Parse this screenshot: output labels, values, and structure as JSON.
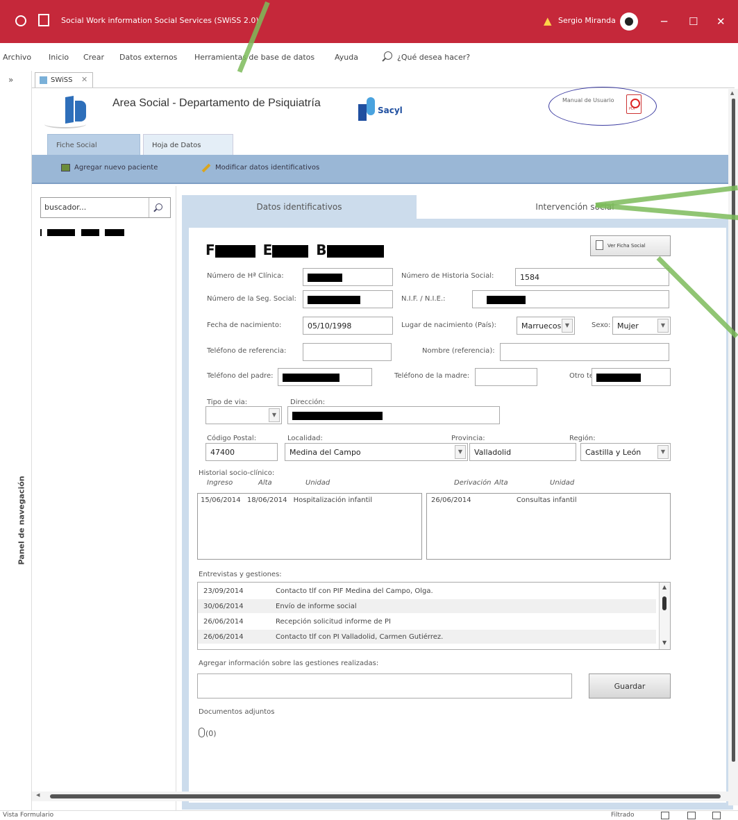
{
  "titlebar": {
    "title": "Social Work information Social Services (SWiSS 2.0)",
    "user": "Sergio Miranda",
    "minimize": "─",
    "maximize": "☐",
    "close": "✕"
  },
  "menu": {
    "items": [
      "Archivo",
      "Inicio",
      "Crear",
      "Datos externos",
      "Herramientas de base de datos",
      "Ayuda"
    ],
    "search_placeholder": "¿Qué desea hacer?"
  },
  "nav": {
    "chevron": "»",
    "label": "Panel de navegación"
  },
  "doc_tab": {
    "label": "SWiSS",
    "close": "✕"
  },
  "header": {
    "title": "Area Social - Departamento de Psiquiatría",
    "brand": "Sacyl",
    "manual_label": "Manual de Usuario"
  },
  "ribbon": {
    "tabs": [
      "Fiche Social",
      "Hoja de Datos"
    ],
    "add_patient": "Agregar nuevo paciente",
    "modify_data": "Modificar datos identificativos"
  },
  "search": {
    "value": "buscador..."
  },
  "content_tabs": [
    "Datos identificativos",
    "Intervención social"
  ],
  "patient": {
    "name_prefix": "F",
    "name_mid": "E",
    "name_end": "B",
    "ver_ficha": "Ver Ficha Social"
  },
  "form": {
    "hc_label": "Número de Hª Clínica:",
    "hs_label": "Número de Historia Social:",
    "hs_value": "1584",
    "ss_label": "Número de la Seg. Social:",
    "nif_label": "N.I.F. / N.I.E.:",
    "dob_label": "Fecha de nacimiento:",
    "dob_value": "05/10/1998",
    "pob_label": "Lugar de nacimiento (País):",
    "pob_value": "Marruecos",
    "sex_label": "Sexo:",
    "sex_value": "Mujer",
    "ref_phone_label": "Teléfono de referencia:",
    "ref_name_label": "Nombre (referencia):",
    "father_phone_label": "Teléfono del padre:",
    "mother_phone_label": "Teléfono de la madre:",
    "other_phone_label": "Otro telf.:",
    "via_label": "Tipo de via:",
    "address_label": "Dirección:",
    "cp_label": "Código Postal:",
    "cp_value": "47400",
    "locality_label": "Localidad:",
    "locality_value": "Medina del Campo",
    "province_label": "Provincia:",
    "province_value": "Valladolid",
    "region_label": "Región:",
    "region_value": "Castilla y León"
  },
  "history": {
    "label": "Historial socio-clínico:",
    "left_headers": [
      "Ingreso",
      "Alta",
      "Unidad"
    ],
    "right_headers": [
      "Derivación",
      "Alta",
      "Unidad"
    ],
    "left_row": {
      "ingreso": "15/06/2014",
      "alta": "18/06/2014",
      "unidad": "Hospitalización infantil"
    },
    "right_row": {
      "derivacion": "26/06/2014",
      "alta": "",
      "unidad": "Consultas infantil"
    }
  },
  "interviews": {
    "label": "Entrevistas y gestiones:",
    "rows": [
      {
        "date": "23/09/2014",
        "text": "Contacto tlf con PIF Medina del Campo, Olga."
      },
      {
        "date": "30/06/2014",
        "text": "Envío de informe social"
      },
      {
        "date": "26/06/2014",
        "text": "Recepción solicitud informe de PI"
      },
      {
        "date": "26/06/2014",
        "text": "Contacto tlf con PI Valladolid, Carmen Gutiérrez."
      }
    ]
  },
  "add_info": {
    "label": "Agregar información sobre las gestiones realizadas:",
    "button": "Guardar"
  },
  "attachments": {
    "label": "Documentos adjuntos",
    "count": "(0)"
  },
  "status": {
    "view": "Vista Formulario",
    "filter": "Filtrado"
  }
}
